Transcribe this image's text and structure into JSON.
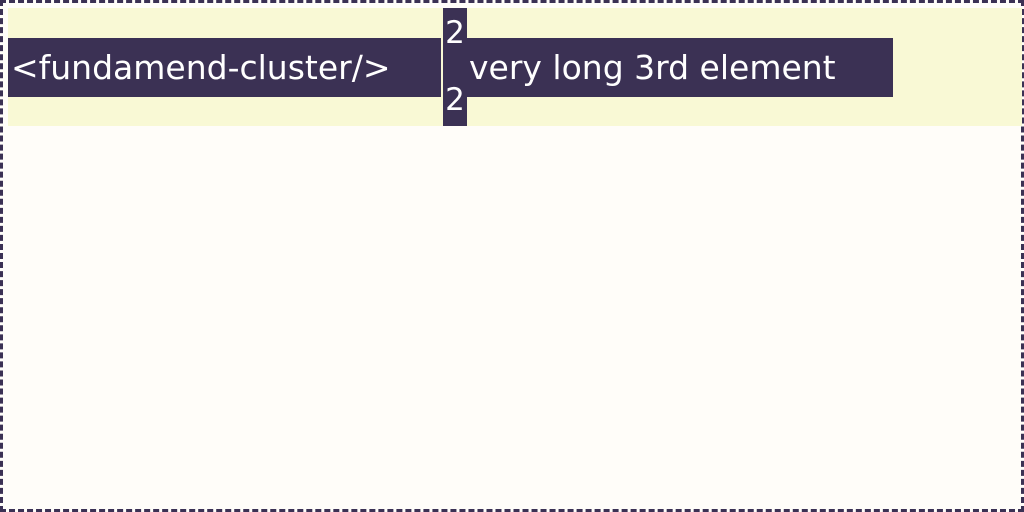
{
  "cluster": {
    "item_1": "<fundamend-cluster/>",
    "item_2": {
      "top": "2",
      "bottom": "2"
    },
    "item_3": "very long 3rd element"
  },
  "colors": {
    "frame_border": "#3b3154",
    "cluster_background": "#f9f9d5",
    "item_background": "#3b3154",
    "item_text": "#ffffff",
    "page_background": "#fffdf9"
  }
}
